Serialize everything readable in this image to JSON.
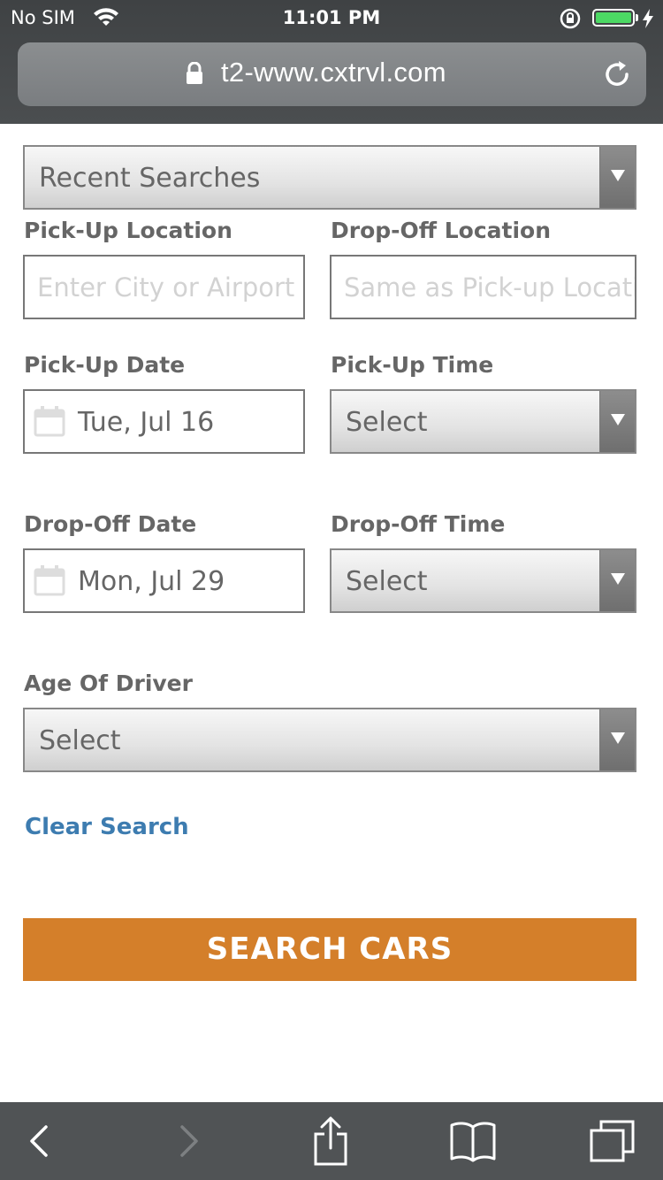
{
  "status_bar": {
    "carrier": "No SIM",
    "time": "11:01 PM"
  },
  "browser": {
    "url": "t2-www.cxtrvl.com"
  },
  "form": {
    "recent_searches": "Recent Searches",
    "pickup_location_label": "Pick-Up Location",
    "pickup_location_placeholder": "Enter City or Airport",
    "dropoff_location_label": "Drop-Off Location",
    "dropoff_location_placeholder": "Same as Pick-up Location",
    "pickup_date_label": "Pick-Up Date",
    "pickup_date_value": "Tue, Jul 16",
    "pickup_time_label": "Pick-Up Time",
    "pickup_time_value": "Select",
    "dropoff_date_label": "Drop-Off Date",
    "dropoff_date_value": "Mon, Jul 29",
    "dropoff_time_label": "Drop-Off Time",
    "dropoff_time_value": "Select",
    "age_label": "Age Of Driver",
    "age_value": "Select",
    "clear_search": "Clear Search",
    "search_button": "SEARCH CARS"
  },
  "colors": {
    "accent_orange": "#d47f2a",
    "link_blue": "#3d7cb0",
    "battery_green": "#4cd964"
  },
  "icons": [
    "wifi-icon",
    "rotation-lock-icon",
    "battery-icon",
    "charging-bolt-icon",
    "padlock-icon",
    "reload-icon",
    "calendar-icon",
    "dropdown-arrow-icon",
    "back-icon",
    "forward-icon",
    "share-icon",
    "bookmarks-icon",
    "tabs-icon"
  ]
}
